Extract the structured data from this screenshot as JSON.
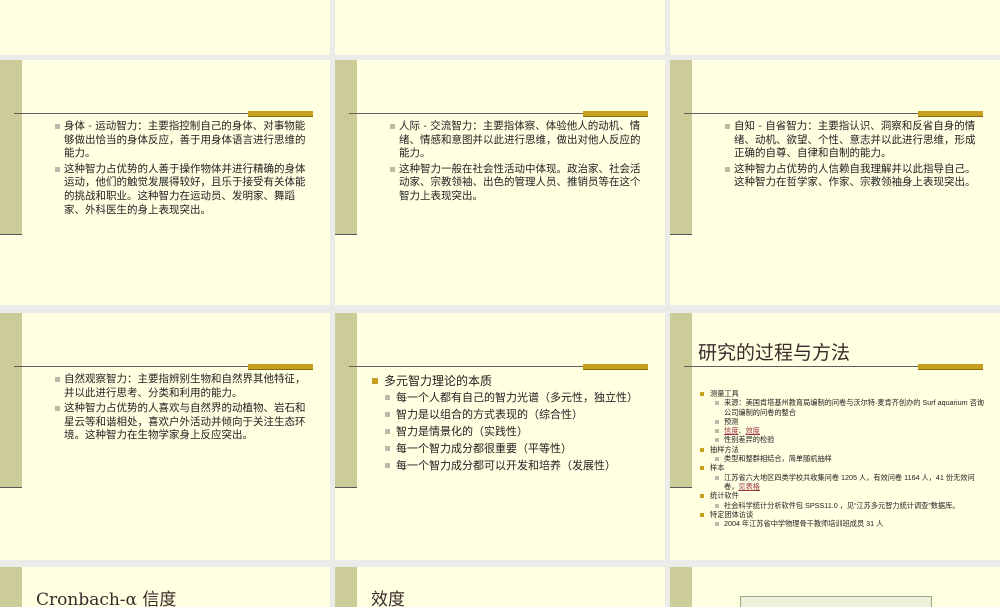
{
  "slides": {
    "body_kinesthetic": [
      "身体 - 运动智力：主要指控制自己的身体、对事物能够做出恰当的身体反应，善于用身体语言进行思维的能力。",
      "这种智力占优势的人善于操作物体并进行精确的身体运动，他们的触觉发展得较好，且乐于接受有关体能的挑战和职业。这种智力在运动员、发明家、舞蹈家、外科医生的身上表现突出。"
    ],
    "interpersonal": [
      "人际 - 交流智力：主要指体察、体验他人的动机、情绪、情感和意图并以此进行思维，做出对他人反应的能力。",
      "这种智力一般在社会性活动中体现。政治家、社会活动家、宗教领袖、出色的管理人员、推销员等在这个智力上表现突出。"
    ],
    "intrapersonal": [
      "自知 - 自省智力：主要指认识、洞察和反省自身的情绪、动机、欲望、个性、意志并以此进行思维，形成正确的自尊、自律和自制的能力。",
      "这种智力占优势的人信赖自我理解并以此指导自己。这种智力在哲学家、作家、宗教领袖身上表现突出。"
    ],
    "naturalist": [
      "自然观察智力：主要指辨别生物和自然界其他特征，并以此进行思考、分类和利用的能力。",
      "这种智力占优势的人喜欢与自然界的动植物、岩石和星云等和谐相处，喜欢户外活动并倾向于关注生态环境。这种智力在生物学家身上反应突出。"
    ],
    "essence": {
      "heading": "多元智力理论的本质",
      "items": [
        "每一个人都有自己的智力光谱（多元性，独立性）",
        "智力是以组合的方式表现的（综合性）",
        "智力是情景化的（实践性）",
        "每一个智力成分都很重要（平等性）",
        "每一个智力成分都可以开发和培养（发展性）"
      ]
    },
    "method": {
      "title": "研究的过程与方法",
      "tools": "测量工具",
      "tools_source": "来源：美国肯塔基州教育局编制的问卷与沃尔特·麦肯齐创办的 Surf aquarium 咨询公司编制的问卷的整合",
      "pretest": "预测",
      "reliability_link": "信度",
      "sep": "、",
      "validity_link": "效度",
      "gender": "性别差异的检验",
      "sampling": "抽样方法",
      "sampling_desc": "类型和整群相结合，简单随机抽样",
      "sample": "样本",
      "sample_desc": "江苏省六大地区四类学校共收集问卷 1205 人，有效问卷 1164 人，41 份无效问卷，",
      "table_link": "见表格",
      "software": "统计软件",
      "software_desc": "社会科学统计分析软件包  SPSS11.0 ，见“江苏多元智力统计调查”数据库。",
      "interview": "特定团体访谈",
      "interview_desc": "2004 年江苏省中学物理骨干教师培训班成员 31 人"
    },
    "cronbach_title": "Cronbach-α 信度",
    "validity_title": "效度"
  }
}
